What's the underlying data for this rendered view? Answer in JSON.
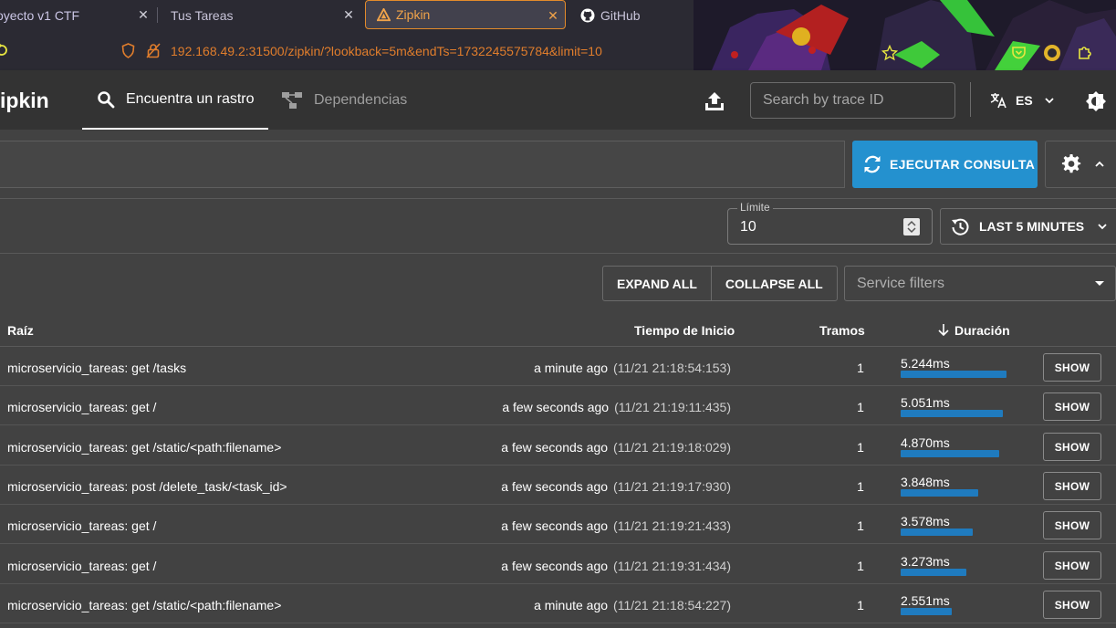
{
  "browser": {
    "tabs": [
      {
        "title": "oyecto v1 CTF"
      },
      {
        "title": "Tus Tareas"
      },
      {
        "title": "Zipkin"
      },
      {
        "title": "GitHub"
      }
    ],
    "close_glyph": "✕",
    "new_tab_glyph": "+",
    "url": "192.168.49.2:31500/zipkin/?lookback=5m&endTs=1732245575784&limit=10"
  },
  "app": {
    "brand": "ipkin",
    "nav": {
      "find_trace": "Encuentra un rastro",
      "dependencies": "Dependencias"
    },
    "search_placeholder": "Search by trace ID",
    "language": "ES"
  },
  "query": {
    "run_label": "EJECUTAR CONSULTA",
    "limit_label": "Límite",
    "limit_value": "10",
    "lookback_label": "LAST 5 MINUTES"
  },
  "controls": {
    "expand_all": "EXPAND ALL",
    "collapse_all": "COLLAPSE ALL",
    "service_filters_placeholder": "Service filters"
  },
  "table": {
    "headers": {
      "root": "Raíz",
      "start_time": "Tiempo de Inicio",
      "spans": "Tramos",
      "duration": "Duración"
    },
    "show_label": "SHOW",
    "rows": [
      {
        "root": "microservicio_tareas: get /tasks",
        "relative": "a minute ago",
        "absolute": "(11/21 21:18:54:153)",
        "spans": "1",
        "duration": "5.244ms",
        "duration_ms": 5.244
      },
      {
        "root": "microservicio_tareas: get /",
        "relative": "a few seconds ago",
        "absolute": "(11/21 21:19:11:435)",
        "spans": "1",
        "duration": "5.051ms",
        "duration_ms": 5.051
      },
      {
        "root": "microservicio_tareas: get /static/<path:filename>",
        "relative": "a few seconds ago",
        "absolute": "(11/21 21:19:18:029)",
        "spans": "1",
        "duration": "4.870ms",
        "duration_ms": 4.87
      },
      {
        "root": "microservicio_tareas: post /delete_task/<task_id>",
        "relative": "a few seconds ago",
        "absolute": "(11/21 21:19:17:930)",
        "spans": "1",
        "duration": "3.848ms",
        "duration_ms": 3.848
      },
      {
        "root": "microservicio_tareas: get /",
        "relative": "a few seconds ago",
        "absolute": "(11/21 21:19:21:433)",
        "spans": "1",
        "duration": "3.578ms",
        "duration_ms": 3.578
      },
      {
        "root": "microservicio_tareas: get /",
        "relative": "a few seconds ago",
        "absolute": "(11/21 21:19:31:434)",
        "spans": "1",
        "duration": "3.273ms",
        "duration_ms": 3.273
      },
      {
        "root": "microservicio_tareas: get /static/<path:filename>",
        "relative": "a minute ago",
        "absolute": "(11/21 21:18:54:227)",
        "spans": "1",
        "duration": "2.551ms",
        "duration_ms": 2.551
      }
    ]
  },
  "colors": {
    "primary": "#2491cf",
    "duration_bar": "#1f7bbf",
    "active_tab_accent": "#e38b2b"
  }
}
